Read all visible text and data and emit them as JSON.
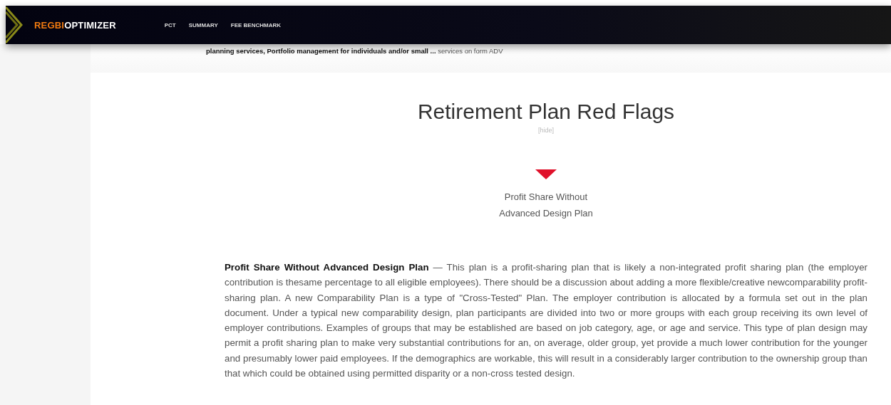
{
  "header": {
    "logo": {
      "accent": "REGBI",
      "rest": "OPTIMIZER"
    },
    "nav": [
      {
        "label": "PCT"
      },
      {
        "label": "SUMMARY"
      },
      {
        "label": "FEE BENCHMARK"
      }
    ]
  },
  "summary_line": {
    "bold": "planning services, Portfolio management for individuals and/or small ...",
    "rest": "services on form ADV"
  },
  "section": {
    "title": "Retirement Plan Red Flags",
    "toggle": "[hide]",
    "flags": [
      {
        "label": "Profit Share Without Advanced Design Plan"
      }
    ],
    "paragraph": "**Profit Share Without Advanced Design Plan** — This plan is a profit-sharing plan that is likely a non-integrated profit sharing plan (the employer contribution is thesame percentage to all eligible employees). There should be a discussion about adding a more flexible/creative newcomparability profit-sharing plan. A new Comparability Plan is a type of \"Cross-Tested\" Plan. The employer contribution is allocated by a formula set out in the plan document. Under a typical new comparability design, plan participants are divided into two or more groups with each group receiving its own level of employer contributions. Examples of groups that may be established are based on job category, age, or age and service. This type of plan design may permit a profit sharing plan to make very substantial contributions for an, on average, older group, yet provide a much lower contribution for the younger and presumably lower paid employees. If the demographics are workable, this will result in a considerably larger contribution to the ownership group than that which could be obtained using permitted disparity or a non-cross tested design."
  }
}
